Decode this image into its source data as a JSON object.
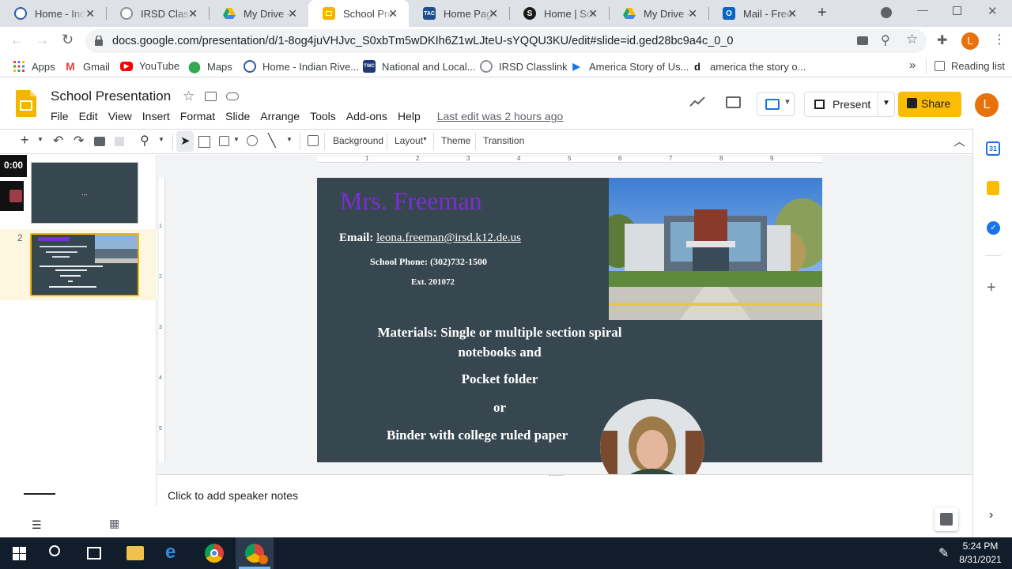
{
  "tabs": [
    {
      "title": "Home - Indi",
      "icon": "indian-river-icon",
      "color": "#2f5aa8"
    },
    {
      "title": "IRSD Classli",
      "icon": "classlink-icon",
      "color": "#8a8f95"
    },
    {
      "title": "My Drive - G",
      "icon": "google-drive-icon",
      "color": "#1fa463"
    },
    {
      "title": "School Pres",
      "icon": "google-slides-icon",
      "color": "#f4b400"
    },
    {
      "title": "Home Page",
      "icon": "tac-icon",
      "color": "#1e4e8c"
    },
    {
      "title": "Home | Sch",
      "icon": "schoology-icon",
      "color": "#1b1b1b"
    },
    {
      "title": "My Drive - G",
      "icon": "google-drive-icon",
      "color": "#1fa463"
    },
    {
      "title": "Mail - Freer",
      "icon": "outlook-icon",
      "color": "#0a64c2"
    }
  ],
  "address": {
    "url": "docs.google.com/presentation/d/1-8og4juVHJvc_S0xbTm5wDKIh6Z1wLJteU-sYQQU3KU/edit#slide=id.ged28bc9a4c_0_0"
  },
  "profile_initial": "L",
  "bookmarks": [
    {
      "label": "Apps"
    },
    {
      "label": "Gmail"
    },
    {
      "label": "YouTube"
    },
    {
      "label": "Maps"
    },
    {
      "label": "Home - Indian Rive..."
    },
    {
      "label": "National and Local..."
    },
    {
      "label": "IRSD Classlink"
    },
    {
      "label": "America Story of Us..."
    },
    {
      "label": "america the story o..."
    }
  ],
  "bookmarks_overflow": "»",
  "reading_list": "Reading list",
  "doc": {
    "title": "School Presentation",
    "menu": [
      "File",
      "Edit",
      "View",
      "Insert",
      "Format",
      "Slide",
      "Arrange",
      "Tools",
      "Add-ons",
      "Help"
    ],
    "last_edit": "Last edit was 2 hours ago",
    "present_label": "Present",
    "share_label": "Share"
  },
  "toolbar": {
    "background": "Background",
    "layout": "Layout",
    "theme": "Theme",
    "transition": "Transition"
  },
  "ruler": [
    "1",
    "2",
    "3",
    "4",
    "5",
    "6",
    "7",
    "8",
    "9"
  ],
  "vruler": [
    "1",
    "2",
    "3",
    "4",
    "5"
  ],
  "filmstrip": {
    "timer": "0:00",
    "slide1_text": "...",
    "slide2_number": "2"
  },
  "slide": {
    "name": "Mrs. Freeman",
    "email_label": "Email:",
    "email": "leona.freeman@irsd.k12.de.us",
    "phone": "School Phone: (302)732-1500",
    "ext": "Ext. 201072",
    "materials_line1": "Materials: Single or multiple section spiral",
    "materials_line2": "notebooks and",
    "pocket": "Pocket folder",
    "or": "or",
    "binder": "Binder with college ruled paper"
  },
  "notes_placeholder": "Click to add speaker notes",
  "taskbar": {
    "time": "5:24 PM",
    "date": "8/31/2021"
  }
}
